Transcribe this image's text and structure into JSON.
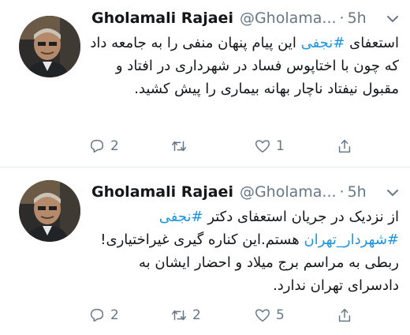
{
  "tweets": [
    {
      "author": {
        "name": "Gholamali Rajaei",
        "handle": "@Gholama..."
      },
      "separator": "·",
      "time": "5h",
      "text": {
        "before": "استعفای ",
        "hashtag": "#نجفی",
        "after": " این پیام پنهان منفی را به جامعه داد که چون با اختاپوس فساد در شهرداری در افتاد و مقبول نیفتاد ناچار بهانه بیماری را پیش کشید."
      },
      "actions": {
        "reply": "2",
        "retweet": "",
        "like": "1",
        "share": ""
      }
    },
    {
      "author": {
        "name": "Gholamali Rajaei",
        "handle": "@Gholama..."
      },
      "separator": "·",
      "time": "5h",
      "text": {
        "before": "از نزدیک در جریان استعفای دکتر ",
        "hashtag": "#نجفی",
        "hashtag2": "#شهردار_تهران",
        "after": " هستم.این کناره گیری غیراختیاری! ربطی به مراسم برج میلاد و احضار ایشان به دادسرای تهران ندارد."
      },
      "actions": {
        "reply": "2",
        "retweet": "2",
        "like": "5",
        "share": ""
      }
    }
  ],
  "colors": {
    "link": "#1b95e0",
    "muted": "#657786",
    "divider": "#e6ecf0"
  },
  "icons": [
    "reply-icon",
    "retweet-icon",
    "like-icon",
    "share-icon",
    "chevron-down-icon"
  ]
}
